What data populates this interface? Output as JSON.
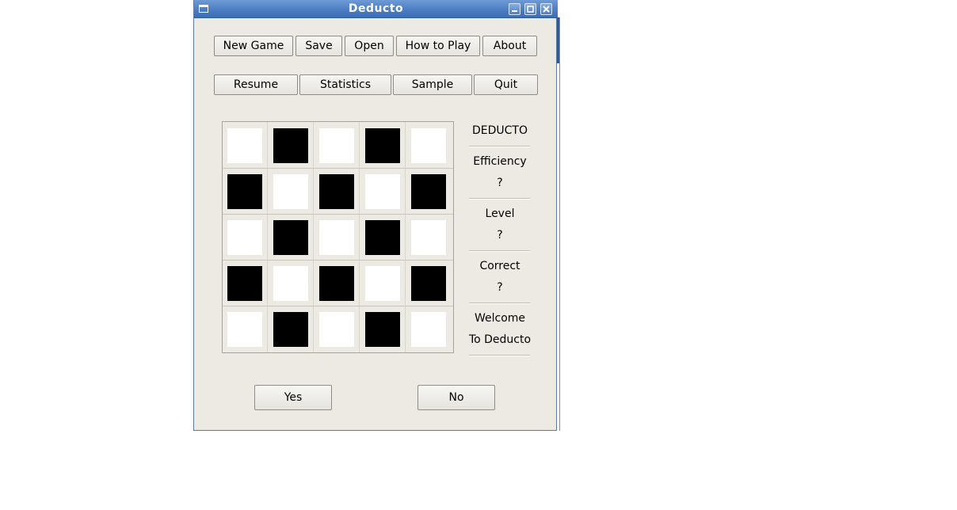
{
  "window": {
    "title": "Deducto"
  },
  "toolbar_row1": [
    {
      "label": "New Game"
    },
    {
      "label": "Save"
    },
    {
      "label": "Open"
    },
    {
      "label": "How to Play"
    },
    {
      "label": "About"
    }
  ],
  "toolbar_row2": [
    {
      "label": "Resume"
    },
    {
      "label": "Statistics"
    },
    {
      "label": "Sample"
    },
    {
      "label": "Quit"
    }
  ],
  "board": {
    "rows": [
      [
        "white",
        "black",
        "white",
        "black",
        "white"
      ],
      [
        "black",
        "white",
        "black",
        "white",
        "black"
      ],
      [
        "white",
        "black",
        "white",
        "black",
        "white"
      ],
      [
        "black",
        "white",
        "black",
        "white",
        "black"
      ],
      [
        "white",
        "black",
        "white",
        "black",
        "white"
      ]
    ]
  },
  "info": {
    "game_name": "DEDUCTO",
    "efficiency_label": "Efficiency",
    "efficiency_value": "?",
    "level_label": "Level",
    "level_value": "?",
    "correct_label": "Correct",
    "correct_value": "?",
    "message_line1": "Welcome",
    "message_line2": "To Deducto"
  },
  "answer": {
    "yes_label": "Yes",
    "no_label": "No"
  },
  "colors": {
    "titlebar": "#4a7cc2",
    "window_bg": "#edeae4",
    "cell_white": "#ffffff",
    "cell_black": "#000000"
  }
}
